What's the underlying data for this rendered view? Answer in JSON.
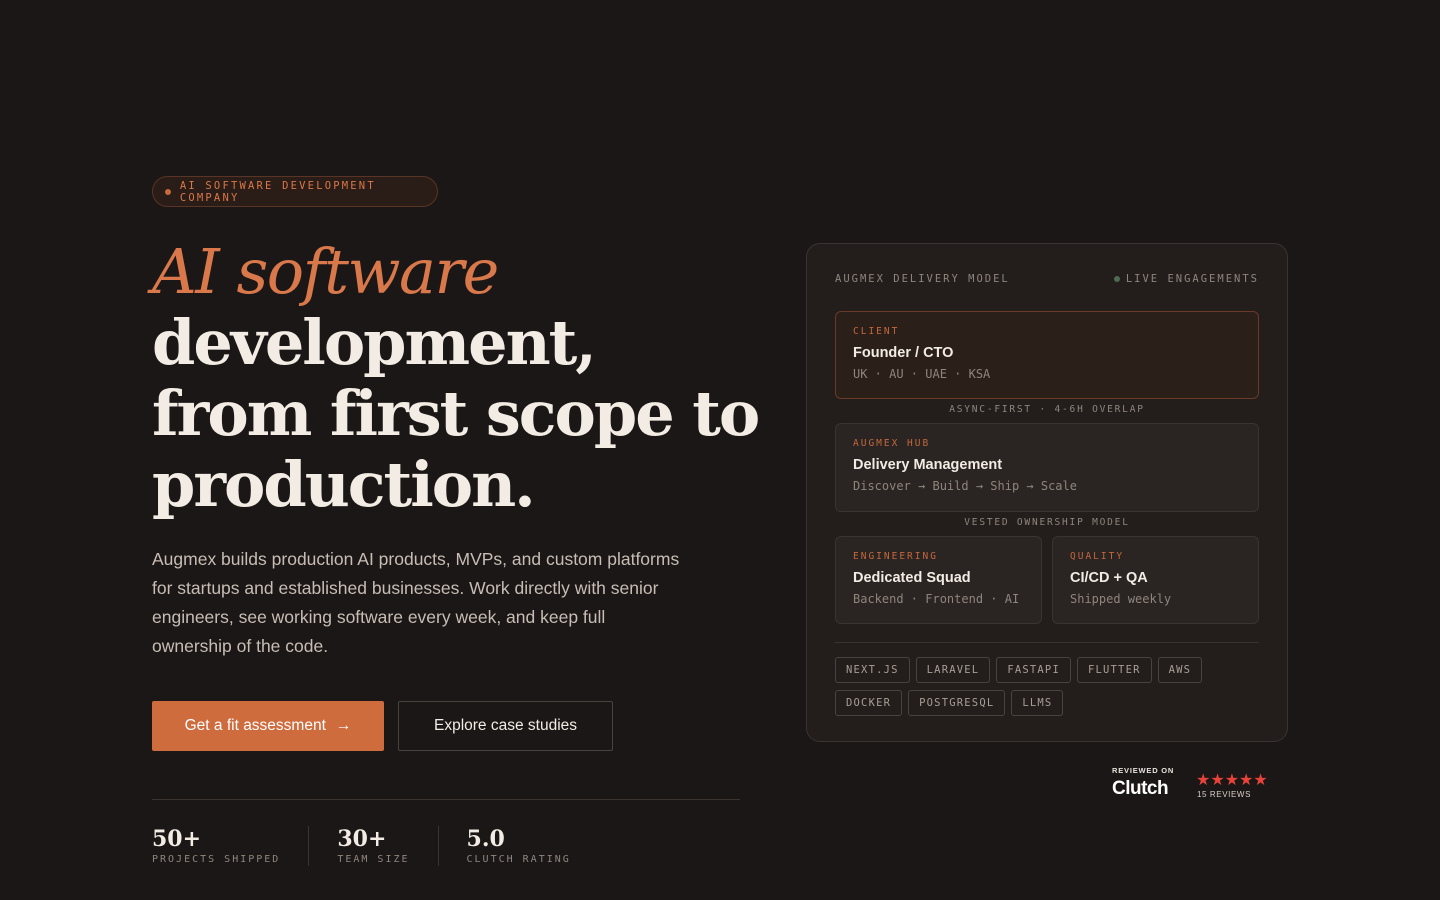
{
  "hero": {
    "badge": "AI SOFTWARE DEVELOPMENT COMPANY",
    "headline_accent": "AI software",
    "headline_line2": "development,",
    "headline_line3": "from first scope to",
    "headline_line4": "production.",
    "lead": "Augmex builds production AI products, MVPs, and custom platforms for startups and established businesses. Work directly with senior engineers, see working software every week, and keep full ownership of the code.",
    "primary_cta": "Get a fit assessment",
    "primary_cta_arrow": "→",
    "secondary_cta": "Explore case studies"
  },
  "stats": [
    {
      "value": "50+",
      "label": "PROJECTS SHIPPED"
    },
    {
      "value": "30+",
      "label": "TEAM SIZE"
    },
    {
      "value": "5.0",
      "label": "CLUTCH RATING"
    }
  ],
  "card": {
    "title": "AUGMEX DELIVERY MODEL",
    "live_label": "LIVE ENGAGEMENTS",
    "client": {
      "tag": "CLIENT",
      "title": "Founder / CTO",
      "sub": "UK · AU · UAE · KSA"
    },
    "connector1": "ASYNC-FIRST · 4-6H OVERLAP",
    "hub": {
      "tag": "AUGMEX HUB",
      "title": "Delivery Management",
      "sub": "Discover → Build → Ship → Scale"
    },
    "connector2": "VESTED OWNERSHIP MODEL",
    "engineering": {
      "tag": "ENGINEERING",
      "title": "Dedicated Squad",
      "sub": "Backend · Frontend · AI"
    },
    "quality": {
      "tag": "QUALITY",
      "title": "CI/CD + QA",
      "sub": "Shipped weekly"
    },
    "chips": [
      "NEXT.JS",
      "LARAVEL",
      "FASTAPI",
      "FLUTTER",
      "AWS",
      "DOCKER",
      "POSTGRESQL",
      "LLMS"
    ]
  },
  "clutch": {
    "reviewed_on": "REVIEWED ON",
    "brand": "Clutch",
    "stars": "★★★★★",
    "reviews": "15 REVIEWS",
    "star_color": "#e8423a"
  },
  "colors": {
    "background": "#1b1716",
    "accent": "#cf6c3e"
  }
}
